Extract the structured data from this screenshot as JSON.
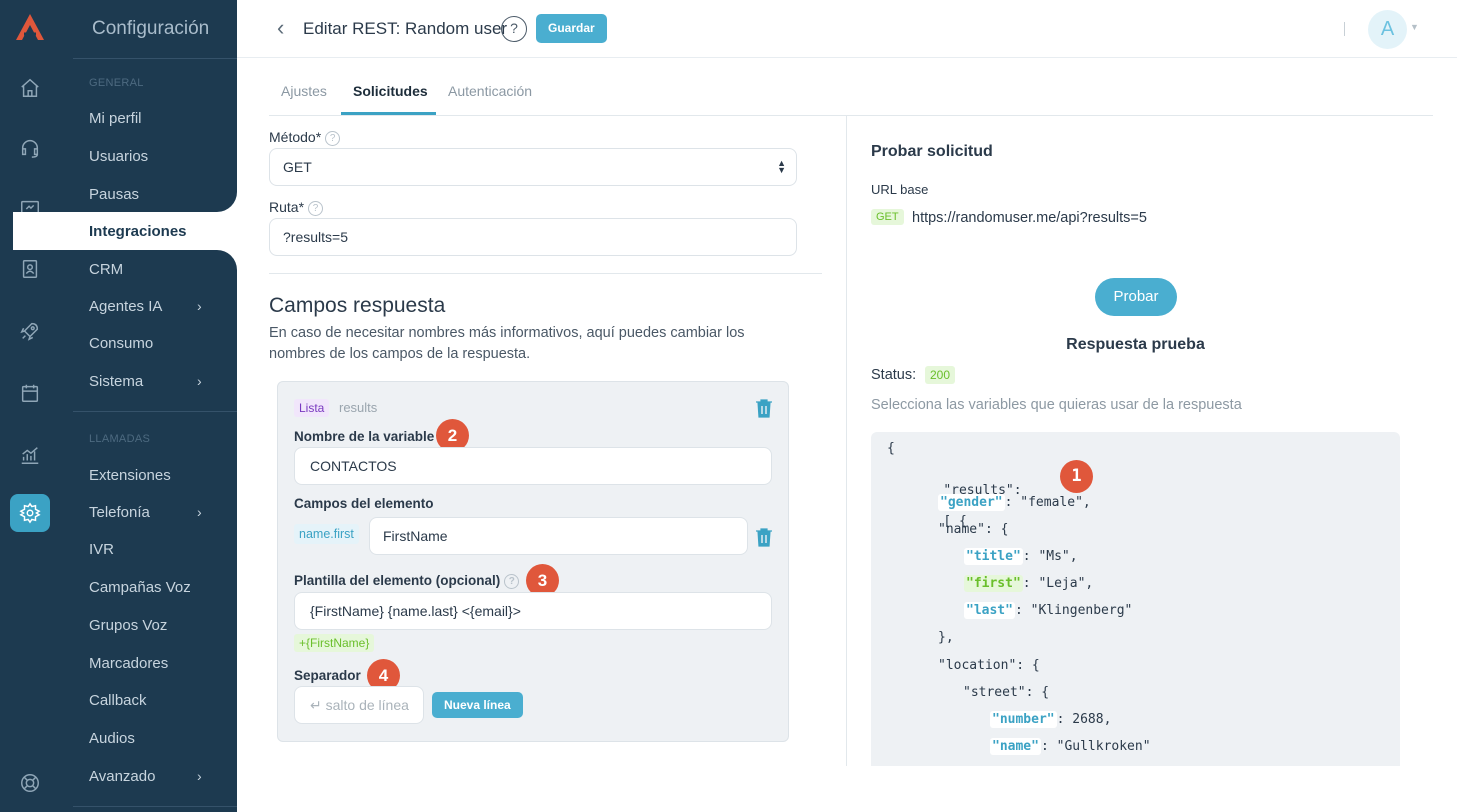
{
  "app": {
    "section_title": "Configuración",
    "colors": {
      "sidebar": "#1d3a50",
      "accent": "#4aaed0",
      "badge_red": "#e0573b"
    }
  },
  "rail": {
    "icons": [
      "logo-icon",
      "home-icon",
      "headset-icon",
      "monitor-icon",
      "contacts-icon",
      "rocket-icon",
      "calendar-icon",
      "chart-icon",
      "settings-icon",
      "support-icon"
    ],
    "active": "settings-icon"
  },
  "sidebar": {
    "general_header": "GENERAL",
    "general_items": [
      {
        "label": "Mi perfil"
      },
      {
        "label": "Usuarios"
      },
      {
        "label": "Pausas"
      },
      {
        "label": "Integraciones",
        "active": true
      },
      {
        "label": "CRM"
      },
      {
        "label": "Agentes IA",
        "has_submenu": true
      },
      {
        "label": "Consumo"
      },
      {
        "label": "Sistema",
        "has_submenu": true
      }
    ],
    "calls_header": "LLAMADAS",
    "calls_items": [
      {
        "label": "Extensiones"
      },
      {
        "label": "Telefonía",
        "has_submenu": true
      },
      {
        "label": "IVR"
      },
      {
        "label": "Campañas Voz"
      },
      {
        "label": "Grupos Voz"
      },
      {
        "label": "Marcadores"
      },
      {
        "label": "Callback"
      },
      {
        "label": "Audios"
      },
      {
        "label": "Avanzado",
        "has_submenu": true
      }
    ]
  },
  "header": {
    "back_icon": "chevron-left-icon",
    "title": "Editar REST: Random user",
    "help": "?",
    "save_label": "Guardar",
    "avatar_letter": "A"
  },
  "tabs": [
    {
      "label": "Ajustes"
    },
    {
      "label": "Solicitudes",
      "active": true
    },
    {
      "label": "Autenticación"
    }
  ],
  "request": {
    "method_label": "Método*",
    "method_value": "GET",
    "route_label": "Ruta*",
    "route_value": "?results=5"
  },
  "response_fields": {
    "title": "Campos respuesta",
    "description": "En caso de necesitar nombres más informativos, aquí puedes cambiar los nombres de los campos de la respuesta.",
    "list_badge": "Lista",
    "list_key": "results",
    "variable_label": "Nombre de la variable",
    "variable_value": "CONTACTOS",
    "item_fields_label": "Campos del elemento",
    "item_field_path": "name.first",
    "item_field_value": "FirstName",
    "template_label": "Plantilla del elemento (opcional)",
    "template_value": "{FirstName} {name.last} <{email}>",
    "template_insert": "+{FirstName}",
    "separator_label": "Separador",
    "separator_placeholder": "↵ salto de línea",
    "newline_button": "Nueva línea",
    "step_badges": [
      "1",
      "2",
      "3",
      "4"
    ]
  },
  "test_panel": {
    "title": "Probar solicitud",
    "base_url_label": "URL base",
    "method_tag": "GET",
    "base_url": "https://randomuser.me/api?results=5",
    "test_button": "Probar",
    "response_title": "Respuesta prueba",
    "status_label": "Status:",
    "status_value": "200",
    "hint": "Selecciona las variables que quieras usar de la respuesta",
    "code": {
      "open": "{",
      "results_key": "\"results\":",
      "results_open": "[ {",
      "gender_key": "\"gender\"",
      "gender_val": ": \"female\",",
      "name_key": "\"name\": {",
      "title_key": "\"title\"",
      "title_val": ": \"Ms\",",
      "first_key": "\"first\"",
      "first_val": ": \"Leja\",",
      "last_key": "\"last\"",
      "last_val": ": \"Klingenberg\"",
      "name_close": "},",
      "location_key": "\"location\": {",
      "street_key": "\"street\": {",
      "number_key": "\"number\"",
      "number_val": ": 2688,",
      "sname_key": "\"name\"",
      "sname_val": ": \"Gullkroken\""
    }
  }
}
